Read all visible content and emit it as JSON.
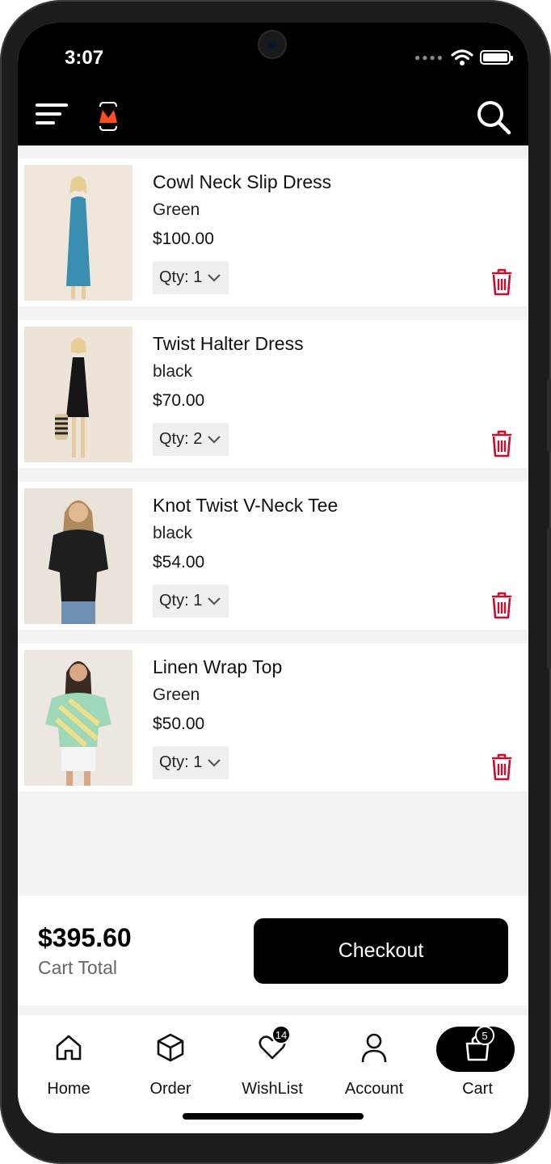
{
  "status": {
    "time": "3:07"
  },
  "header": {
    "logo_letter": "M"
  },
  "cart": {
    "items": [
      {
        "name": "Cowl Neck Slip Dress",
        "color": "Green",
        "price": "$100.00",
        "qty": "Qty: 1",
        "image": "cowl-neck-slip-dress-photo",
        "swatch": "#3a8fb0"
      },
      {
        "name": "Twist Halter Dress",
        "color": "black",
        "price": "$70.00",
        "qty": "Qty: 2",
        "image": "twist-halter-dress-photo",
        "swatch": "#161616"
      },
      {
        "name": "Knot Twist V-Neck Tee",
        "color": "black",
        "price": "$54.00",
        "qty": "Qty: 1",
        "image": "knot-twist-v-neck-tee-photo",
        "swatch": "#1e1e1e"
      },
      {
        "name": "Linen Wrap Top",
        "color": "Green",
        "price": "$50.00",
        "qty": "Qty: 1",
        "image": "linen-wrap-top-photo",
        "swatch": "#9fd8b8"
      }
    ]
  },
  "summary": {
    "total": "$395.60",
    "total_label": "Cart Total",
    "checkout_label": "Checkout"
  },
  "nav": {
    "items": [
      {
        "label": "Home",
        "icon": "home-icon"
      },
      {
        "label": "Order",
        "icon": "box-icon"
      },
      {
        "label": "WishList",
        "icon": "heart-icon",
        "badge": "14"
      },
      {
        "label": "Account",
        "icon": "person-icon"
      },
      {
        "label": "Cart",
        "icon": "shopping-bag-icon",
        "badge": "5",
        "active": true
      }
    ]
  },
  "colors": {
    "accent": "#c8102e",
    "topbar": "#000000",
    "brand_logo": "#ff4d1f"
  }
}
